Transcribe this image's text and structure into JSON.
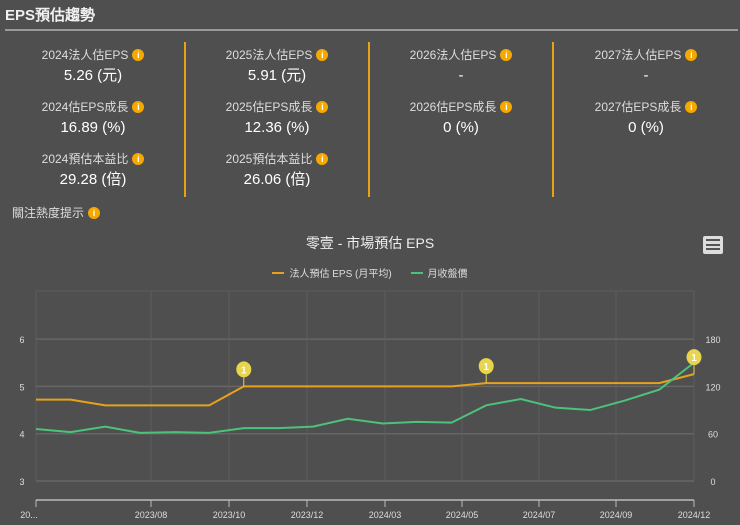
{
  "header": {
    "title": "EPS預估趨勢"
  },
  "columns": [
    {
      "rows": [
        {
          "label": "2024法人估EPS",
          "value": "5.26 (元)"
        },
        {
          "label": "2024估EPS成長",
          "value": "16.89 (%)"
        },
        {
          "label": "2024預估本益比",
          "value": "29.28 (倍)"
        }
      ]
    },
    {
      "rows": [
        {
          "label": "2025法人估EPS",
          "value": "5.91 (元)"
        },
        {
          "label": "2025估EPS成長",
          "value": "12.36 (%)"
        },
        {
          "label": "2025預估本益比",
          "value": "26.06 (倍)"
        }
      ]
    },
    {
      "rows": [
        {
          "label": "2026法人估EPS",
          "value": "-"
        },
        {
          "label": "2026估EPS成長",
          "value": "0 (%)"
        }
      ]
    },
    {
      "rows": [
        {
          "label": "2027法人估EPS",
          "value": "-"
        },
        {
          "label": "2027估EPS成長",
          "value": "0 (%)"
        }
      ]
    }
  ],
  "info_icon": "i",
  "hint": {
    "label": "關注熱度提示"
  },
  "chart_data": {
    "type": "line",
    "title": "零壹 - 市場預估 EPS",
    "x": [
      "2023/05",
      "2023/06",
      "2023/07",
      "2023/08",
      "2023/09",
      "2023/10",
      "2023/11",
      "2023/12",
      "2024/01",
      "2024/02",
      "2024/03",
      "2024/04",
      "2024/05",
      "2024/06",
      "2024/07",
      "2024/08",
      "2024/09",
      "2024/10",
      "2024/11",
      "2024/12"
    ],
    "x_tick_labels": [
      "20...",
      "2023/08",
      "2023/10",
      "2023/12",
      "2024/03",
      "2024/05",
      "2024/07",
      "2024/09",
      "2024/12"
    ],
    "left_axis": {
      "ticks": [
        "3",
        "4",
        "5",
        "6"
      ],
      "range": [
        3,
        6.9
      ]
    },
    "right_axis": {
      "ticks": [
        "0",
        "60",
        "120",
        "180"
      ],
      "range": [
        0,
        234
      ]
    },
    "series": [
      {
        "name": "法人預估 EPS (月平均)",
        "color": "#e8a21a",
        "axis": "left",
        "values": [
          4.72,
          4.72,
          4.6,
          4.6,
          4.6,
          4.6,
          5.0,
          5.0,
          5.0,
          5.0,
          5.0,
          5.0,
          5.0,
          5.07,
          5.07,
          5.07,
          5.07,
          5.07,
          5.07,
          5.26
        ]
      },
      {
        "name": "月收盤價",
        "color": "#4cc27a",
        "axis": "right",
        "values": [
          66,
          62,
          69,
          61,
          62,
          61,
          67,
          67,
          69,
          79,
          73,
          75,
          74,
          96,
          104,
          93,
          90,
          102,
          116,
          150
        ]
      }
    ],
    "flags": [
      {
        "index": 6,
        "label": "1"
      },
      {
        "index": 13,
        "label": "1"
      },
      {
        "index": 19,
        "label": "1"
      }
    ]
  }
}
